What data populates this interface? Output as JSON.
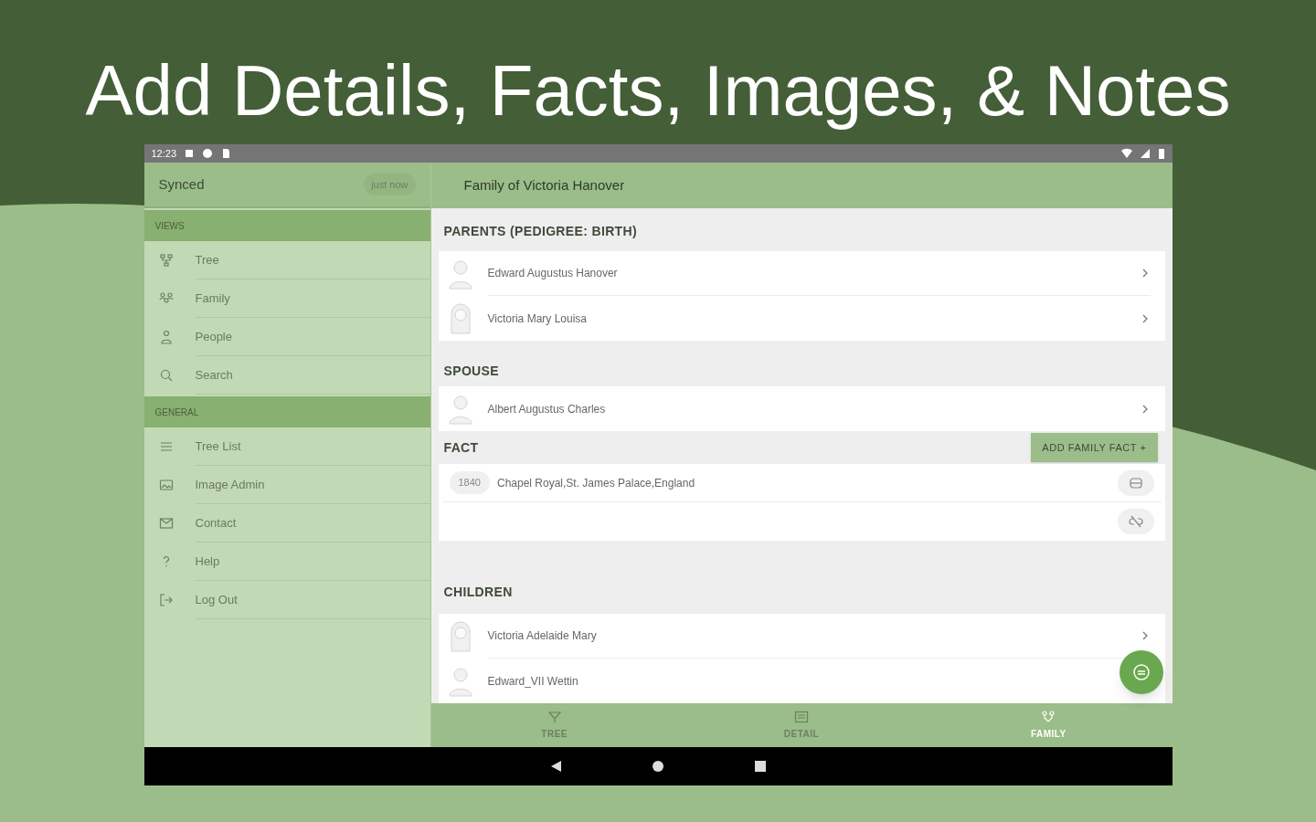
{
  "headline": "Add Details, Facts, Images, & Notes",
  "status_bar": {
    "time": "12:23"
  },
  "sidebar": {
    "status": "Synced",
    "sync_time": "just now",
    "sections": [
      {
        "title": "VIEWS",
        "items": [
          {
            "label": "Tree"
          },
          {
            "label": "Family"
          },
          {
            "label": "People"
          },
          {
            "label": "Search"
          }
        ]
      },
      {
        "title": "GENERAL",
        "items": [
          {
            "label": "Tree List"
          },
          {
            "label": "Image Admin"
          },
          {
            "label": "Contact"
          },
          {
            "label": "Help"
          },
          {
            "label": "Log Out"
          }
        ]
      }
    ]
  },
  "main": {
    "title": "Family of Victoria Hanover",
    "parents": {
      "title": "PARENTS (PEDIGREE: BIRTH)",
      "people": [
        {
          "name": "Edward Augustus Hanover",
          "kind": "male"
        },
        {
          "name": "Victoria Mary Louisa",
          "kind": "female"
        }
      ]
    },
    "spouse": {
      "title": "SPOUSE",
      "people": [
        {
          "name": "Albert Augustus Charles",
          "kind": "male"
        }
      ]
    },
    "fact": {
      "title": "FACT",
      "button": "ADD FAMILY FACT +",
      "year": "1840",
      "place": "Chapel Royal,St. James Palace,England"
    },
    "children": {
      "title": "CHILDREN",
      "people": [
        {
          "name": "Victoria Adelaide Mary",
          "kind": "female"
        },
        {
          "name": "Edward_VII Wettin",
          "kind": "male"
        }
      ]
    }
  },
  "bottom_tabs": [
    {
      "label": "TREE",
      "selected": false
    },
    {
      "label": "DETAIL",
      "selected": false
    },
    {
      "label": "FAMILY",
      "selected": true
    }
  ]
}
